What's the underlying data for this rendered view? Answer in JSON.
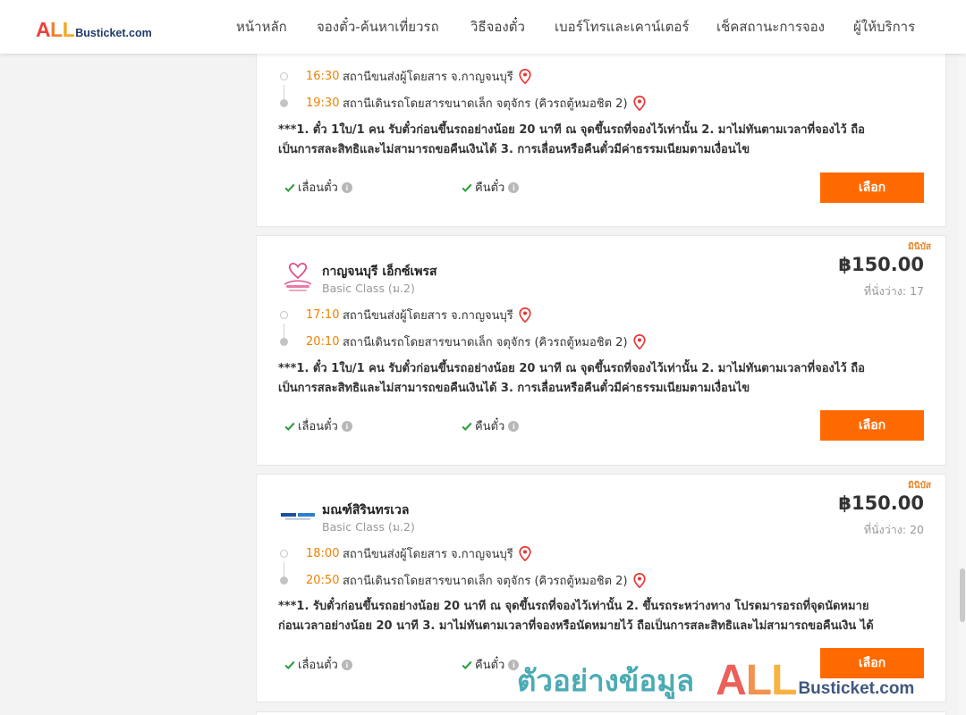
{
  "header": {
    "logo": {
      "all": "ALL",
      "rest": "Busticket.com"
    },
    "nav": [
      "หน้าหลัก",
      "จองตั๋ว-ค้นหาเที่ยวรถ",
      "วิธีจองตั๋ว",
      "เบอร์โทรและเคาน์เตอร์",
      "เช็คสถานะการจอง",
      "ผู้ให้บริการ"
    ]
  },
  "labels": {
    "seats": "ที่นั่งว่าง:",
    "reschedule": "เลื่อนตั๋ว",
    "refund": "คืนตั๋ว",
    "select": "เลือก",
    "info": "i"
  },
  "trips": [
    {
      "category": "",
      "operator": "",
      "class": "",
      "price": "",
      "seats": "",
      "depart_time": "16:30",
      "depart_station": "สถานีขนส่งผู้โดยสาร จ.กาญจนบุรี",
      "arrive_time": "19:30",
      "arrive_station": "สถานีเดินรถโดยสารขนาดเล็ก จตุจักร (คิวรถตู้หมอชิต 2)",
      "note": [
        "***1. ตั๋ว 1ใบ/1 คน รับตั๋วก่อนขึ้นรถอย่างน้อย 20 นาที ณ จุดขึ้นรถที่จองไว้เท่านั้น 2. มาไม่ทันตามเวลาที่จองไว้ ถือ",
        "เป็นการสละสิทธิและไม่สามารถขอคืนเงินได้ 3. การเลื่อนหรือคืนตั๋วมีค่าธรรมเนียมตามเงื่อนไข"
      ]
    },
    {
      "category": "มินิบัส",
      "operator": "กาญจนบุรี เอ็กซ์เพรส",
      "class": "Basic Class (ม.2)",
      "price": "฿150.00",
      "seats": "17",
      "depart_time": "17:10",
      "depart_station": "สถานีขนส่งผู้โดยสาร จ.กาญจนบุรี",
      "arrive_time": "20:10",
      "arrive_station": "สถานีเดินรถโดยสารขนาดเล็ก จตุจักร (คิวรถตู้หมอชิต 2)",
      "note": [
        "***1. ตั๋ว 1ใบ/1 คน รับตั๋วก่อนขึ้นรถอย่างน้อย 20 นาที ณ จุดขึ้นรถที่จองไว้เท่านั้น 2. มาไม่ทันตามเวลาที่จองไว้ ถือ",
        "เป็นการสละสิทธิและไม่สามารถขอคืนเงินได้ 3. การเลื่อนหรือคืนตั๋วมีค่าธรรมเนียมตามเงื่อนไข"
      ]
    },
    {
      "category": "มินิบัส",
      "operator": "มณฑ์สิรินทรเวล",
      "class": "Basic Class (ม.2)",
      "price": "฿150.00",
      "seats": "20",
      "depart_time": "18:00",
      "depart_station": "สถานีขนส่งผู้โดยสาร จ.กาญจนบุรี",
      "arrive_time": "20:50",
      "arrive_station": "สถานีเดินรถโดยสารขนาดเล็ก จตุจักร (คิวรถตู้หมอชิต 2)",
      "note": [
        "***1. รับตั๋วก่อนขึ้นรถอย่างน้อย 20 นาที ณ จุดขึ้นรถที่จองไว้เท่านั้น 2. ขึ้นรถระหว่างทาง โปรดมารอรถที่จุดนัดหมาย",
        "ก่อนเวลาอย่างน้อย 20 นาที 3. มาไม่ทันตามเวลาที่จองหรือนัดหมายไว้ ถือเป็นการสละสิทธิและไม่สามารถขอคืนเงิน ได้"
      ]
    }
  ],
  "watermark": {
    "text": "ตัวอย่างข้อมูล",
    "all": "ALL",
    "rest": "Busticket.com"
  },
  "colors": {
    "accent": "#ff6a00",
    "time": "#f08000",
    "pin": "#e53935",
    "check": "#2e9e3e",
    "category": "#e8862a"
  }
}
